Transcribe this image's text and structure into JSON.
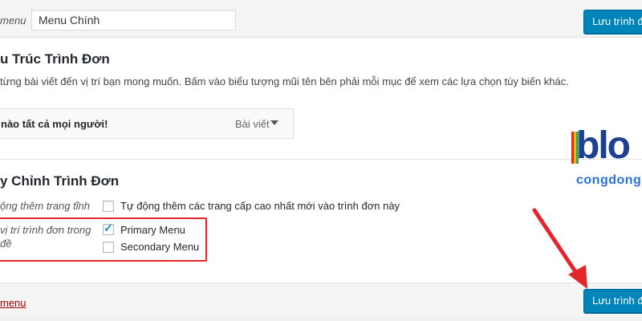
{
  "header": {
    "menu_name_label": "menu",
    "menu_name_value": "Menu Chính",
    "save_label": "Lưu trình đơn"
  },
  "structure": {
    "title": "u Trúc Trình Đơn",
    "description": "từng bài viết đến vị trí bạn mong muốn. Bấm vào biểu tượng mũi tên bên phải mỗi mục để xem các lựa chọn tùy biến khác.",
    "menu_item": {
      "title": "nào tất cả mọi người!",
      "type": "Bài viết"
    }
  },
  "settings": {
    "title": "y Chỉnh Trình Đơn",
    "auto_add": {
      "label": "ộng thêm trang tĩnh",
      "option_label": "Tự động thêm các trang cấp cao nhất mới vào trình đơn này",
      "checked": false
    },
    "location": {
      "label": "vị trí trình đơn trong đề",
      "options": [
        {
          "label": "Primary Menu",
          "checked": true
        },
        {
          "label": "Secondary Menu",
          "checked": false
        }
      ]
    }
  },
  "footer": {
    "delete_label": "menu",
    "save_label": "Lưu trình đơn"
  },
  "watermark": {
    "text": "blo",
    "subtext": "congdong"
  },
  "colors": {
    "primary_button": "#0085ba",
    "highlight_box": "#e2262b",
    "delete_link": "#aa0000"
  }
}
